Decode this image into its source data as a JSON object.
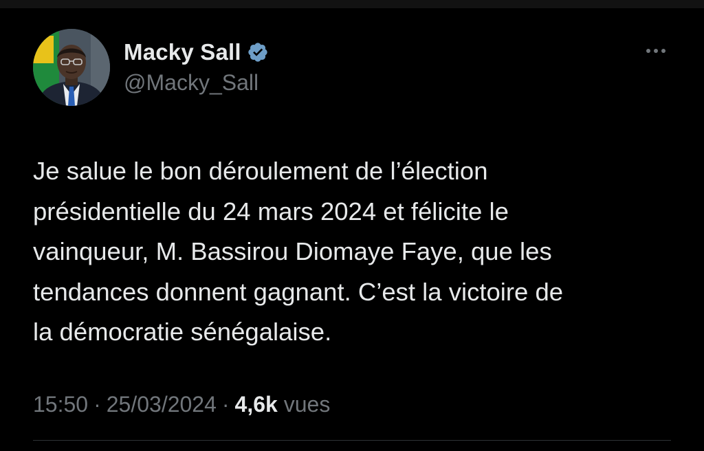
{
  "author": {
    "display_name": "Macky Sall",
    "handle": "@Macky_Sall",
    "verified": true,
    "verified_color": "#1d9bf0"
  },
  "tweet": {
    "lines": [
      "Je salue le bon déroulement de l’élection",
      "présidentielle du 24 mars 2024 et félicite le",
      "vainqueur, M. Bassirou Diomaye Faye, que les",
      "tendances donnent gagnant. C’est la victoire de",
      "la démocratie sénégalaise."
    ]
  },
  "meta": {
    "time": "15:50",
    "separator": "·",
    "date": "25/03/2024",
    "views_count": "4,6k",
    "views_label": "vues"
  },
  "icons": {
    "more": "more-horizontal-icon",
    "verified": "verified-badge-icon"
  },
  "colors": {
    "background": "#000000",
    "text_primary": "#e7e9ea",
    "text_secondary": "#71767b",
    "divider": "#2f3336"
  }
}
